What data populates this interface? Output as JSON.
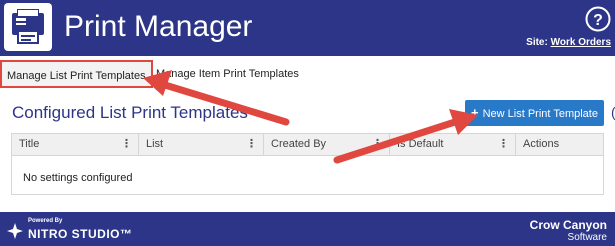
{
  "header": {
    "title": "Print Manager",
    "site_label": "Site:",
    "site_name": "Work Orders",
    "icon": "printer-icon",
    "help_icon": "help-icon",
    "bg_color": "#2c3587"
  },
  "tabs": [
    {
      "label": "Manage List Print Templates",
      "active": true
    },
    {
      "label": "Manage Item Print Templates",
      "active": false
    }
  ],
  "section": {
    "title": "Configured List Print Templates",
    "new_button_label": "New List Print Template",
    "new_button_icon": "plus-icon",
    "button_color": "#2979c9"
  },
  "table": {
    "columns": [
      "Title",
      "List",
      "Created By",
      "Is Default",
      "Actions"
    ],
    "empty_message": "No settings configured"
  },
  "footer": {
    "powered_by": "Powered By",
    "nitro": "NITRO STUDIO™",
    "brand_line1": "Crow Canyon",
    "brand_line2": "Software"
  },
  "annotations": {
    "arrow_color": "#e0473f",
    "arrow_icon": "annotation-arrow"
  }
}
